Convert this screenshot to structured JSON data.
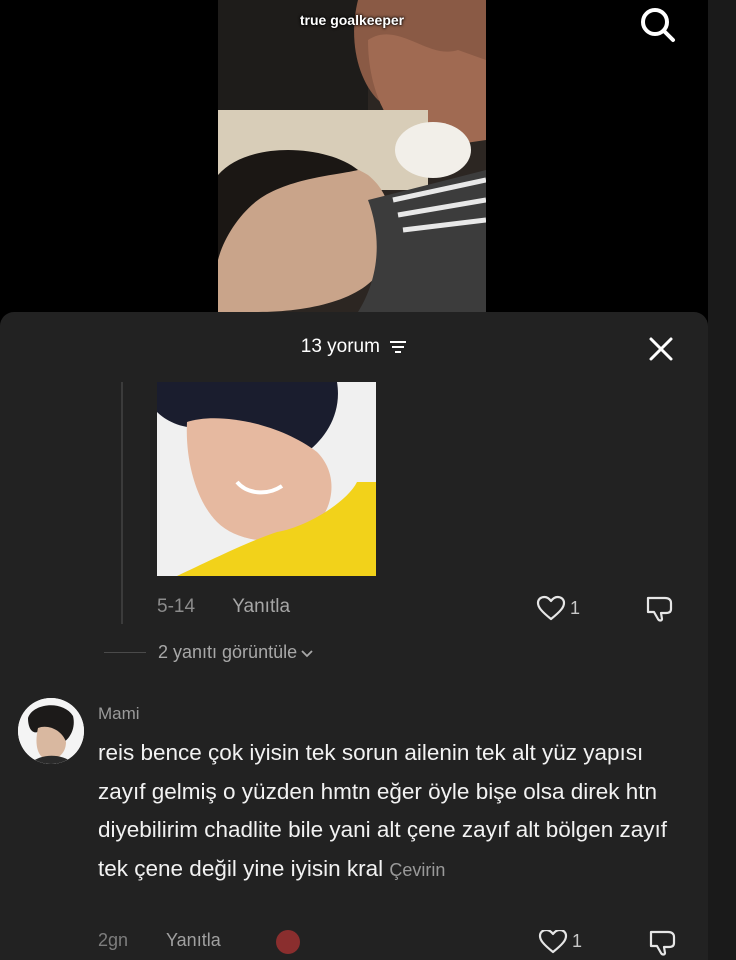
{
  "video": {
    "caption": "true goalkeeper",
    "search_icon": "search-icon"
  },
  "comments_sheet": {
    "count_label": "13 yorum",
    "filter_icon": "filter-icon",
    "close_icon": "close-icon"
  },
  "reply": {
    "date": "5-14",
    "reply_label": "Yanıtla",
    "likes": "1",
    "view_replies_label": "2 yanıtı görüntüle"
  },
  "comment": {
    "username": "Mami",
    "text": "reis bence çok iyisin tek sorun ailenin tek alt yüz yapısı zayıf gelmiş o yüzden hmtn eğer öyle bişe olsa direk htn diyebilirim chadlite bile yani alt çene zayıf alt bölgen zayıf tek çene değil yine iyisin kral",
    "translate_label": "Çevirin",
    "date": "2gn",
    "reply_label": "Yanıtla",
    "likes": "1"
  }
}
